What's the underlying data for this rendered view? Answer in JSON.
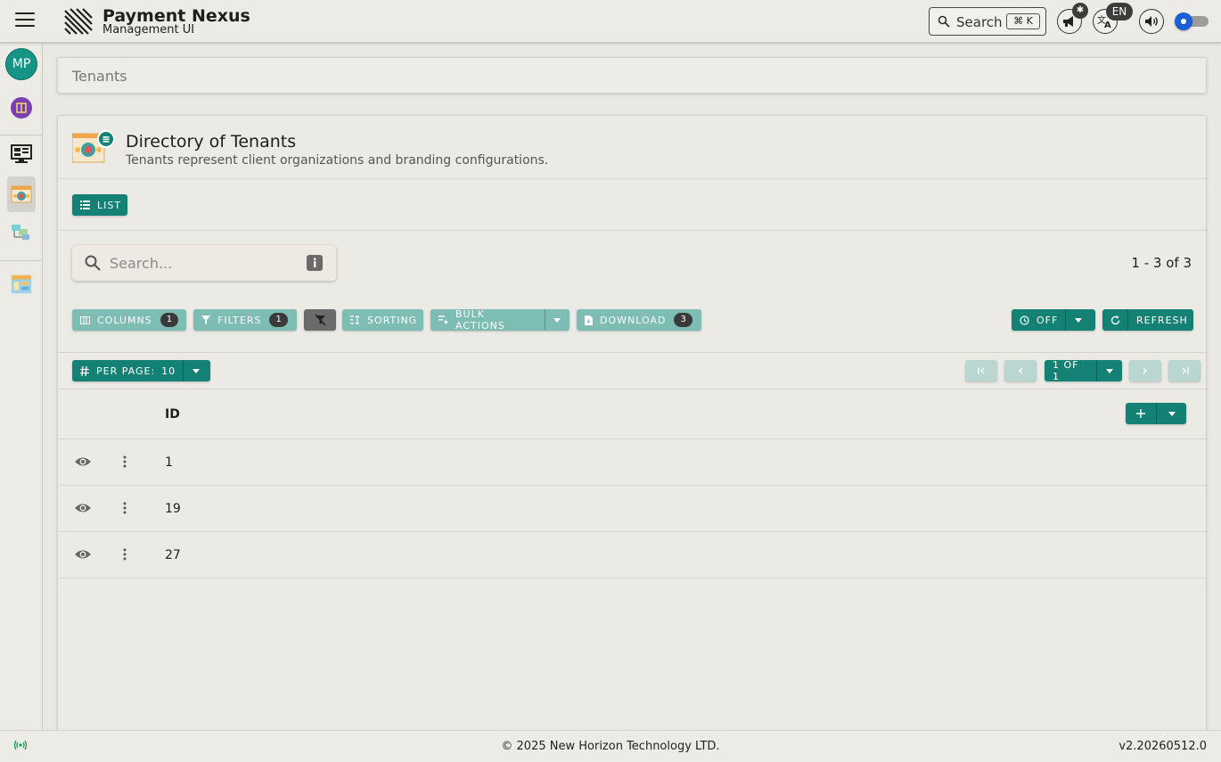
{
  "header": {
    "app_title": "Payment Nexus",
    "app_subtitle": "Management UI",
    "search_label": "Search",
    "search_shortcut": "⌘ K",
    "language_badge": "EN",
    "accent_color": "#138274"
  },
  "sidebar": {
    "avatar_initials": "MP",
    "items": [
      {
        "icon": "puzzle-icon"
      },
      {
        "icon": "monitor-icon"
      },
      {
        "icon": "tenants-icon",
        "active": true
      },
      {
        "icon": "network-icon"
      },
      {
        "icon": "dashboard-icon"
      }
    ]
  },
  "breadcrumb": {
    "current": "Tenants"
  },
  "page": {
    "title": "Directory of Tenants",
    "subtitle": "Tenants represent client organizations and branding configurations.",
    "view_button": "LIST"
  },
  "search": {
    "placeholder": "Search..."
  },
  "result_count": "1 - 3 of 3",
  "toolbar": {
    "columns_label": "COLUMNS",
    "columns_count": "1",
    "filters_label": "FILTERS",
    "filters_count": "1",
    "sorting_label": "SORTING",
    "bulk_actions_label": "BULK ACTIONS",
    "download_label": "DOWNLOAD",
    "download_count": "3",
    "auto_refresh_label": "OFF",
    "refresh_label": "REFRESH"
  },
  "pagination": {
    "per_page_label": "PER PAGE:",
    "per_page_value": "10",
    "page_label": "1 OF 1"
  },
  "table": {
    "columns": [
      "ID"
    ],
    "rows": [
      {
        "id": "1"
      },
      {
        "id": "19"
      },
      {
        "id": "27"
      }
    ]
  },
  "footer": {
    "copyright": "© 2025 New Horizon Technology LTD.",
    "version": "v2.20260512.0"
  }
}
